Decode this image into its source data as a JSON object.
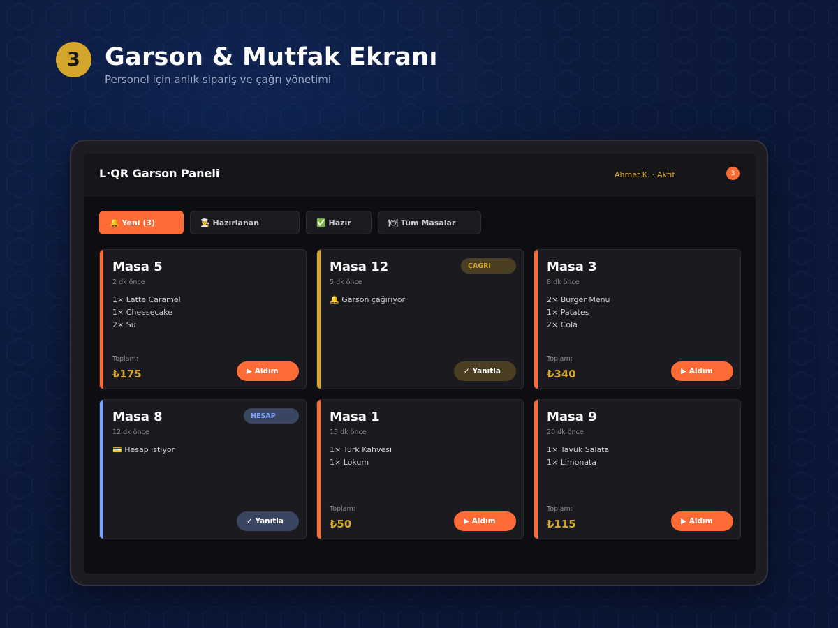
{
  "header": {
    "step": "3",
    "title": "Garson & Mutfak Ekranı",
    "subtitle": "Personel için anlık sipariş ve çağrı yönetimi"
  },
  "app": {
    "title": "L·QR Garson Paneli",
    "user_status": "Ahmet K. · Aktif",
    "notification_count": "3"
  },
  "tabs": [
    {
      "label": "🔔 Yeni (3)",
      "active": true
    },
    {
      "label": "👨‍🍳 Hazırlanan",
      "active": false
    },
    {
      "label": "✅ Hazır",
      "active": false
    },
    {
      "label": "🍽 Tüm Masalar",
      "active": false
    }
  ],
  "cards": [
    {
      "name": "Masa 5",
      "time": "2 dk önce",
      "items": [
        "1× Latte Caramel",
        "1× Cheesecake",
        "2× Su"
      ],
      "total_label": "Toplam:",
      "total": "₺175",
      "action": "▶ Aldım",
      "tag": ""
    },
    {
      "name": "Masa 12",
      "time": "5 dk önce",
      "items": [
        "🔔 Garson çağırıyor"
      ],
      "total_label": "",
      "total": "",
      "action": "✓ Yanıtla",
      "tag": "ÇAĞRI"
    },
    {
      "name": "Masa 3",
      "time": "8 dk önce",
      "items": [
        "2× Burger Menu",
        "1× Patates",
        "2× Cola"
      ],
      "total_label": "Toplam:",
      "total": "₺340",
      "action": "▶ Aldım",
      "tag": ""
    },
    {
      "name": "Masa 8",
      "time": "12 dk önce",
      "items": [
        "💳 Hesap istiyor"
      ],
      "total_label": "",
      "total": "",
      "action": "✓ Yanıtla",
      "tag": "HESAP"
    },
    {
      "name": "Masa 1",
      "time": "15 dk önce",
      "items": [
        "1× Türk Kahvesi",
        "1× Lokum"
      ],
      "total_label": "Toplam:",
      "total": "₺50",
      "action": "▶ Aldım",
      "tag": ""
    },
    {
      "name": "Masa 9",
      "time": "20 dk önce",
      "items": [
        "1× Tavuk Salata",
        "1× Limonata"
      ],
      "total_label": "Toplam:",
      "total": "₺115",
      "action": "▶ Aldım",
      "tag": ""
    }
  ],
  "colors": {
    "accent_orange": "#ff6b35",
    "accent_gold": "#d4a72c",
    "accent_blue": "#7fa4ff"
  }
}
